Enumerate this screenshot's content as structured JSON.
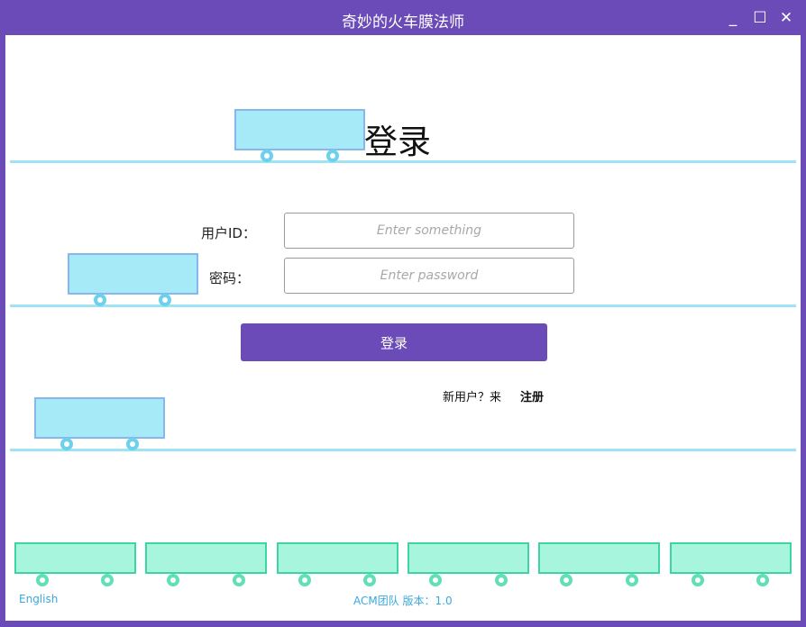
{
  "window": {
    "title": "奇妙的火车膜法师",
    "controls": {
      "minimize": "_",
      "maximize": "☐",
      "close": "✕"
    }
  },
  "login": {
    "heading": "登录",
    "user_id_label": "用户ID：",
    "user_id_placeholder": "Enter something",
    "password_label": "密码：",
    "password_placeholder": "Enter password",
    "login_button": "登录",
    "new_user_prompt": "新用户？来",
    "register_link": "注册"
  },
  "footer": {
    "language": "English",
    "version": "ACM团队 版本：1.0"
  },
  "colors": {
    "accent": "#6a4bb8",
    "rail": "#9fe3f5",
    "train_car": "#a6eaf8",
    "green_car": "#a7f5dc",
    "link": "#3aa8de"
  }
}
